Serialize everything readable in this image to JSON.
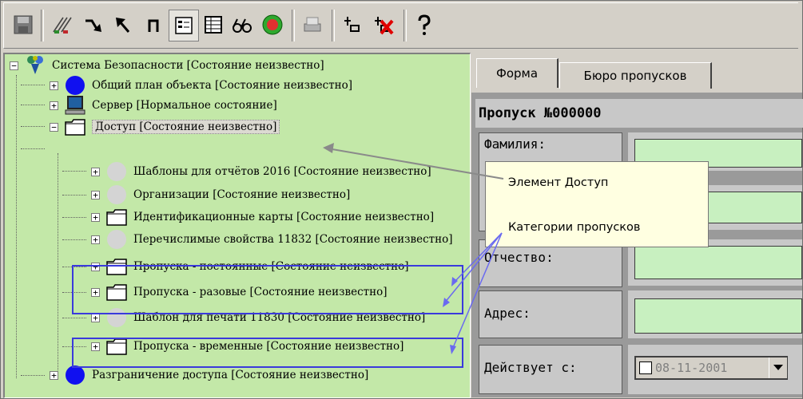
{
  "tree": {
    "root": "Система Безопасности [Состояние неизвестно]",
    "items": [
      {
        "label": "Общий план объекта [Состояние неизвестно]",
        "icon": "blue-circle-icon"
      },
      {
        "label": "Сервер [Нормальное состояние]",
        "icon": "computer-icon"
      },
      {
        "label": "Доступ [Состояние неизвестно]",
        "icon": "folder-icon"
      },
      {
        "label": "Шаблоны для отчётов 2016 [Состояние неизвестно]",
        "icon": "gray-circle-icon"
      },
      {
        "label": "Организации [Состояние неизвестно]",
        "icon": "gray-circle-icon"
      },
      {
        "label": "Идентификационные карты [Состояние неизвестно]",
        "icon": "folder-icon"
      },
      {
        "label": "Перечислимые свойства 11832 [Состояние неизвестно]",
        "icon": "gray-circle-icon"
      },
      {
        "label": "Пропуска - постоянные [Состояние неизвестно]",
        "icon": "folder-icon"
      },
      {
        "label": "Пропуска - разовые [Состояние неизвестно]",
        "icon": "folder-icon"
      },
      {
        "label": "Шаблон для печати 11830 [Состояние неизвестно]",
        "icon": "gray-circle-icon"
      },
      {
        "label": "Пропуска - временные [Состояние неизвестно]",
        "icon": "folder-icon"
      },
      {
        "label": "Разграничение доступа [Состояние неизвестно]",
        "icon": "blue-circle-icon"
      }
    ]
  },
  "callouts": {
    "access_element": "Элемент Доступ",
    "pass_categories": "Категории пропусков"
  },
  "tabs": [
    "Форма",
    "Бюро пропусков"
  ],
  "form": {
    "title": "Пропуск №000000",
    "labels": {
      "surname": "Фамилия:",
      "patronymic": "Отчество:",
      "address": "Адрес:",
      "valid_from": "Действует с:"
    },
    "valid_from_value": "08-11-2001"
  },
  "colors": {
    "tree_bg": "#c3e8a8",
    "input_bg": "#c8f0c0",
    "callout_border": "#3a3adc",
    "tip_bg": "#ffffe1"
  }
}
